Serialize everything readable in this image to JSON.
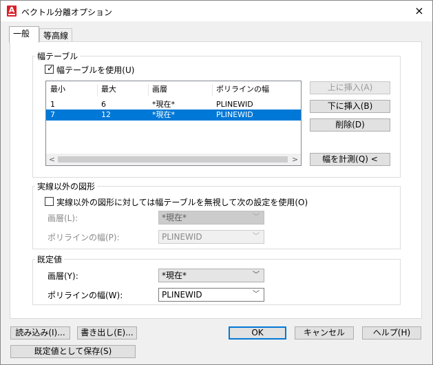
{
  "window": {
    "title": "ベクトル分離オプション",
    "app_icon": "A"
  },
  "tabs": [
    {
      "label": "一般"
    },
    {
      "label": "等高線"
    }
  ],
  "width_table": {
    "group_title": "幅テーブル",
    "use_checkbox_label": "幅テーブルを使用(U)",
    "use_checked": true,
    "columns": [
      "最小",
      "最大",
      "画層",
      "ポリラインの幅"
    ],
    "rows": [
      [
        "1",
        "6",
        "*現在*",
        "PLINEWID"
      ],
      [
        "7",
        "12",
        "*現在*",
        "PLINEWID"
      ]
    ],
    "selected_row": 1,
    "buttons": {
      "insert_above": "上に挿入(A)",
      "insert_below": "下に挿入(B)",
      "delete": "削除(D)",
      "measure": "幅を計測(Q) <"
    }
  },
  "non_solid": {
    "group_title": "実線以外の図形",
    "checkbox_label": "実線以外の図形に対しては幅テーブルを無視して次の設定を使用(O)",
    "checked": false,
    "layer_label": "画層(L):",
    "layer_value": "*現在*",
    "pline_label": "ポリラインの幅(P):",
    "pline_value": "PLINEWID"
  },
  "defaults": {
    "group_title": "既定値",
    "layer_label": "画層(Y):",
    "layer_value": "*現在*",
    "pline_label": "ポリラインの幅(W):",
    "pline_value": "PLINEWID"
  },
  "footer": {
    "load": "読み込み(I)...",
    "export": "書き出し(E)...",
    "save_default": "既定値として保存(S)",
    "ok": "OK",
    "cancel": "キャンセル",
    "help": "ヘルプ(H)"
  },
  "icons": {
    "close": "×",
    "chevron": "﹀",
    "left": "<",
    "right": ">",
    "check": "✓"
  },
  "colors": {
    "selection": "#0078d7",
    "app_icon": "#d8202a"
  }
}
